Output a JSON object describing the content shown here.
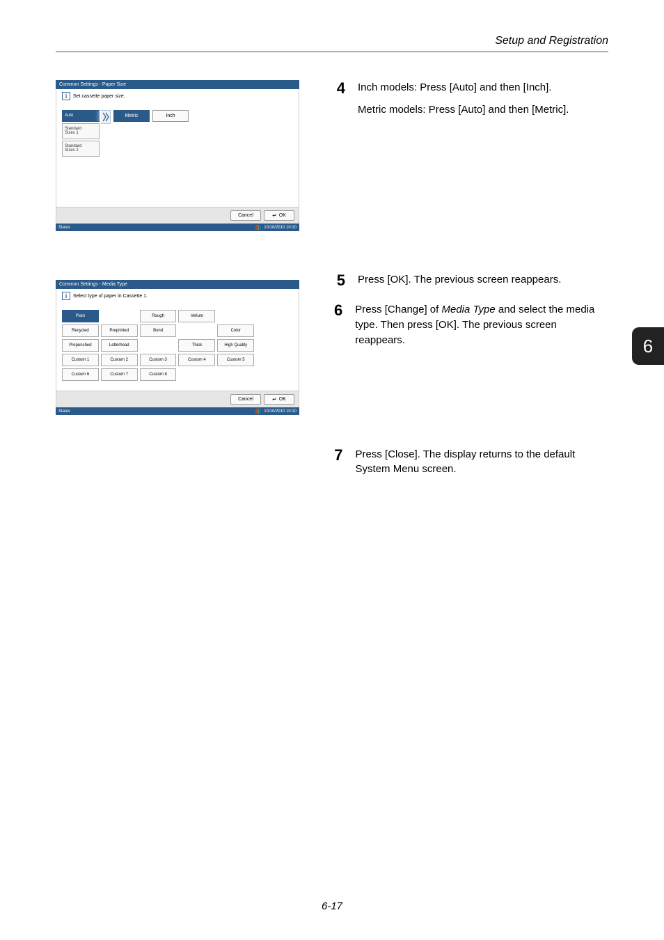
{
  "header": {
    "section": "Setup and Registration"
  },
  "panel1": {
    "title": "Common Settings - Paper Size",
    "info": "Set cassette paper size.",
    "tabs": [
      {
        "label": "Auto",
        "selected": true
      },
      {
        "label": "Standard\nSizes 1",
        "selected": false
      },
      {
        "label": "Standard\nSizes 2",
        "selected": false
      }
    ],
    "options": [
      {
        "label": "Metric",
        "selected": true
      },
      {
        "label": "Inch",
        "selected": false
      }
    ],
    "cancel": "Cancel",
    "ok": "OK",
    "status": "Status",
    "datetime": "10/10/2010  10:10"
  },
  "panel2": {
    "title": "Common Settings - Media Type",
    "info": "Select type of paper in Cassette 1.",
    "grid": [
      [
        "Plain",
        "",
        "Rough",
        "Vellum",
        "",
        ""
      ],
      [
        "Recycled",
        "Preprinted",
        "Bond",
        "",
        "Color",
        ""
      ],
      [
        "Prepunched",
        "Letterhead",
        "",
        "Thick",
        "High Quality",
        ""
      ],
      [
        "Custom 1",
        "Custom 2",
        "Custom 3",
        "Custom 4",
        "Custom 5",
        ""
      ],
      [
        "Custom 6",
        "Custom 7",
        "Custom 8",
        "",
        "",
        ""
      ]
    ],
    "selected": "Plain",
    "cancel": "Cancel",
    "ok": "OK",
    "status": "Status",
    "datetime": "10/10/2010   10:10"
  },
  "steps": {
    "s4a": "Inch models: Press [Auto] and then [Inch].",
    "s4b": "Metric models: Press [Auto] and then [Metric].",
    "s5": "Press [OK]. The previous screen reappears.",
    "s6a": "Press [Change] of ",
    "s6_em": "Media Type",
    "s6b": " and select the media type. Then press [OK]. The previous screen reappears.",
    "s7": "Press [Close]. The display returns to the default System Menu screen."
  },
  "side_tab": "6",
  "footer": "6-17"
}
